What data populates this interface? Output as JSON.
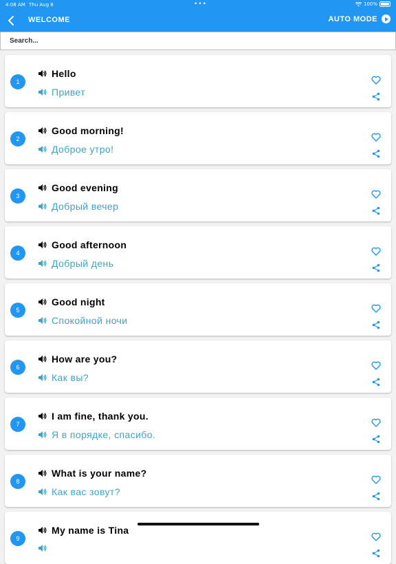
{
  "status": {
    "time": "4:08 AM",
    "date": "Thu Aug 8",
    "battery": "100%"
  },
  "appbar": {
    "title": "WELCOME",
    "auto_mode": "AUTO MODE"
  },
  "search": {
    "placeholder": "Search..."
  },
  "phrases": [
    {
      "num": "1",
      "en": "Hello",
      "ru": "Привет"
    },
    {
      "num": "2",
      "en": "Good morning!",
      "ru": "Доброе утро!"
    },
    {
      "num": "3",
      "en": "Good evening",
      "ru": "Добрый вечер"
    },
    {
      "num": "4",
      "en": "Good afternoon",
      "ru": "Добрый день"
    },
    {
      "num": "5",
      "en": "Good night",
      "ru": "Спокойной ночи"
    },
    {
      "num": "6",
      "en": "How are you?",
      "ru": "Как вы?"
    },
    {
      "num": "7",
      "en": "I am fine, thank you.",
      "ru": "Я в порядке, спасибо."
    },
    {
      "num": "8",
      "en": "What is your name?",
      "ru": "Как вас зовут?"
    },
    {
      "num": "9",
      "en": "My name is Tina",
      "ru": ""
    }
  ],
  "colors": {
    "primary": "#2196f3",
    "translation": "#3aa5c9"
  },
  "icons": {
    "back": "chevron-left-icon",
    "speaker": "speaker-icon",
    "favorite": "heart-outline-icon",
    "share": "share-icon",
    "auto": "play-circle-icon"
  }
}
